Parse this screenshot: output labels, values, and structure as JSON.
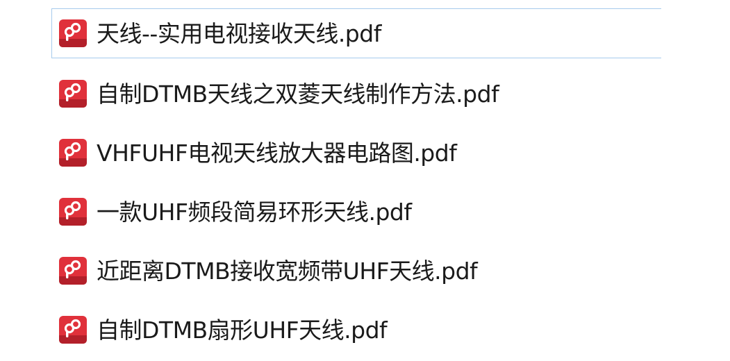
{
  "icons": {
    "file_icon": "pdf-file-icon",
    "icon_color": "#e0313b",
    "icon_shade": "#b3202a"
  },
  "files": [
    {
      "name": "天线--实用电视接收天线.pdf",
      "selected": true
    },
    {
      "name": "自制DTMB天线之双菱天线制作方法.pdf",
      "selected": false
    },
    {
      "name": "VHFUHF电视天线放大器电路图.pdf",
      "selected": false
    },
    {
      "name": "一款UHF频段简易环形天线.pdf",
      "selected": false
    },
    {
      "name": "近距离DTMB接收宽频带UHF天线.pdf",
      "selected": false
    },
    {
      "name": "自制DTMB扇形UHF天线.pdf",
      "selected": false
    }
  ]
}
